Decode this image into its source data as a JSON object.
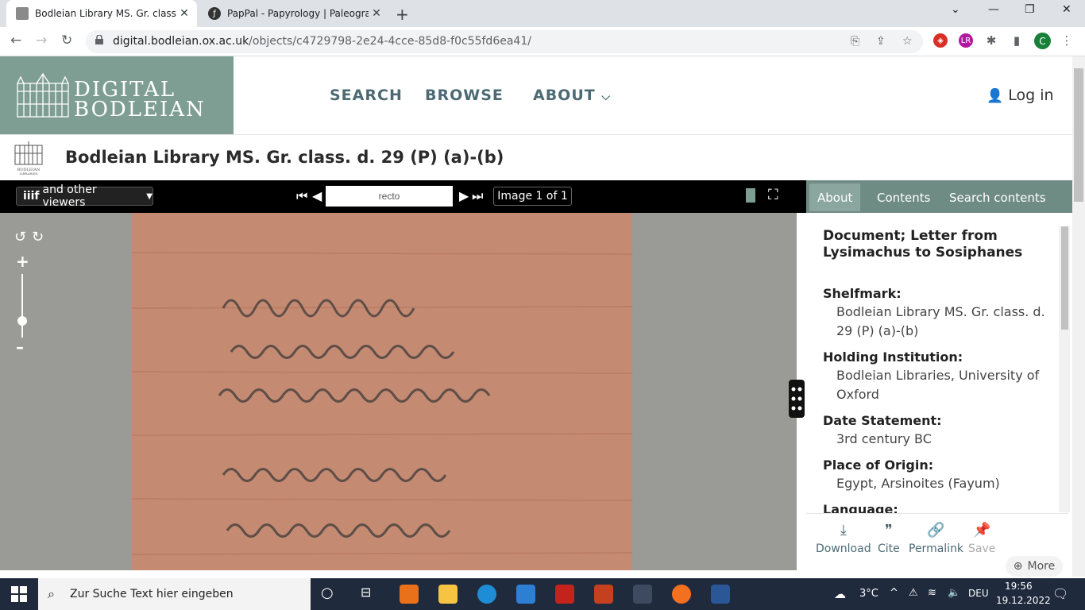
{
  "browser": {
    "tabs": [
      {
        "title": "Bodleian Library MS. Gr. class. d.",
        "active": true
      },
      {
        "title": "PapPal - Papyrology | Paleograph",
        "active": false
      }
    ],
    "url_domain": "digital.bodleian.ox.ac.uk",
    "url_path": "/objects/c4729798-2e24-4cce-85d8-f0c55fd6ea41/",
    "profile_initial": "C"
  },
  "site": {
    "logo_line1": "DIGITAL",
    "logo_line2": "BODLEIAN",
    "nav": {
      "search": "SEARCH",
      "browse": "BROWSE",
      "about": "ABOUT"
    },
    "login": "Log in",
    "small_logo_text": "BODLEIAN\nLIBRARIES",
    "page_title": "Bodleian Library MS. Gr. class. d. 29 (P) (a)-(b)"
  },
  "viewer": {
    "viewers_label": "and other viewers",
    "page_value": "recto",
    "image_count": "Image 1 of 1"
  },
  "sidebar": {
    "tabs": {
      "about": "About",
      "contents": "Contents",
      "search": "Search contents"
    },
    "doc_title": "Document; Letter from Lysimachus to Sosiphanes",
    "fields": [
      {
        "label": "Shelfmark:",
        "value": "Bodleian Library MS. Gr. class. d. 29 (P) (a)-(b)"
      },
      {
        "label": "Holding Institution:",
        "value": "Bodleian Libraries, University of Oxford"
      },
      {
        "label": "Date Statement:",
        "value": "3rd century BC"
      },
      {
        "label": "Place of Origin:",
        "value": "Egypt, Arsinoites (Fayum)"
      },
      {
        "label": "Language:",
        "value": ""
      }
    ],
    "actions": {
      "download": "Download",
      "cite": "Cite",
      "permalink": "Permalink",
      "save": "Save"
    },
    "more": "More"
  },
  "taskbar": {
    "search_placeholder": "Zur Suche Text hier eingeben",
    "weather": "3°C",
    "lang": "DEU",
    "time": "19:56",
    "date": "19.12.2022"
  }
}
